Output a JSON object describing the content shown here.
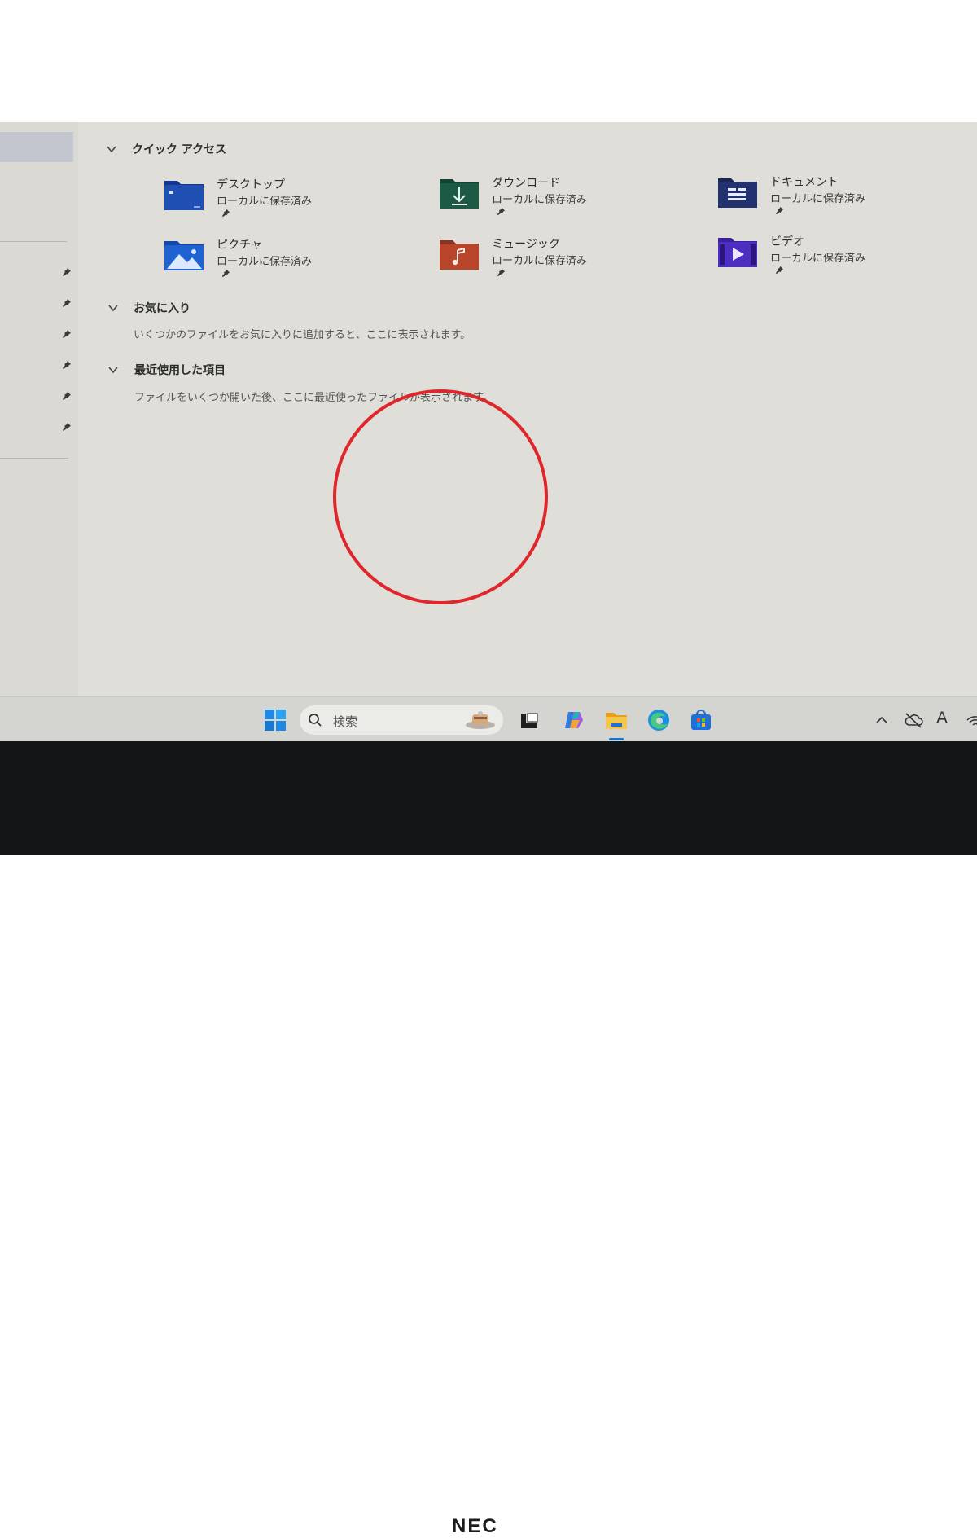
{
  "quick_access": {
    "title": "クイック アクセス",
    "items": [
      {
        "name": "デスクトップ",
        "status": "ローカルに保存済み",
        "icon": "desktop-folder-icon"
      },
      {
        "name": "ダウンロード",
        "status": "ローカルに保存済み",
        "icon": "downloads-folder-icon"
      },
      {
        "name": "ドキュメント",
        "status": "ローカルに保存済み",
        "icon": "documents-folder-icon"
      },
      {
        "name": "ピクチャ",
        "status": "ローカルに保存済み",
        "icon": "pictures-folder-icon"
      },
      {
        "name": "ミュージック",
        "status": "ローカルに保存済み",
        "icon": "music-folder-icon"
      },
      {
        "name": "ビデオ",
        "status": "ローカルに保存済み",
        "icon": "videos-folder-icon"
      }
    ]
  },
  "favorites": {
    "title": "お気に入り",
    "description": "いくつかのファイルをお気に入りに追加すると、ここに表示されます。"
  },
  "recent": {
    "title": "最近使用した項目",
    "description": "ファイルをいくつか開いた後、ここに最近使ったファイルが表示されます。"
  },
  "taskbar": {
    "search_placeholder": "検索",
    "apps": [
      "start-icon",
      "task-view-icon",
      "copilot-icon",
      "file-explorer-icon",
      "edge-icon",
      "store-icon"
    ],
    "tray_text": "A"
  },
  "device_brand": "NEC",
  "colors": {
    "annotation_circle": "#e0262b",
    "folder_blue": "#1f4fb3",
    "folder_green": "#1c5a46",
    "folder_navy": "#23326f",
    "folder_red": "#b8452a",
    "folder_purple": "#4c2fc0"
  }
}
